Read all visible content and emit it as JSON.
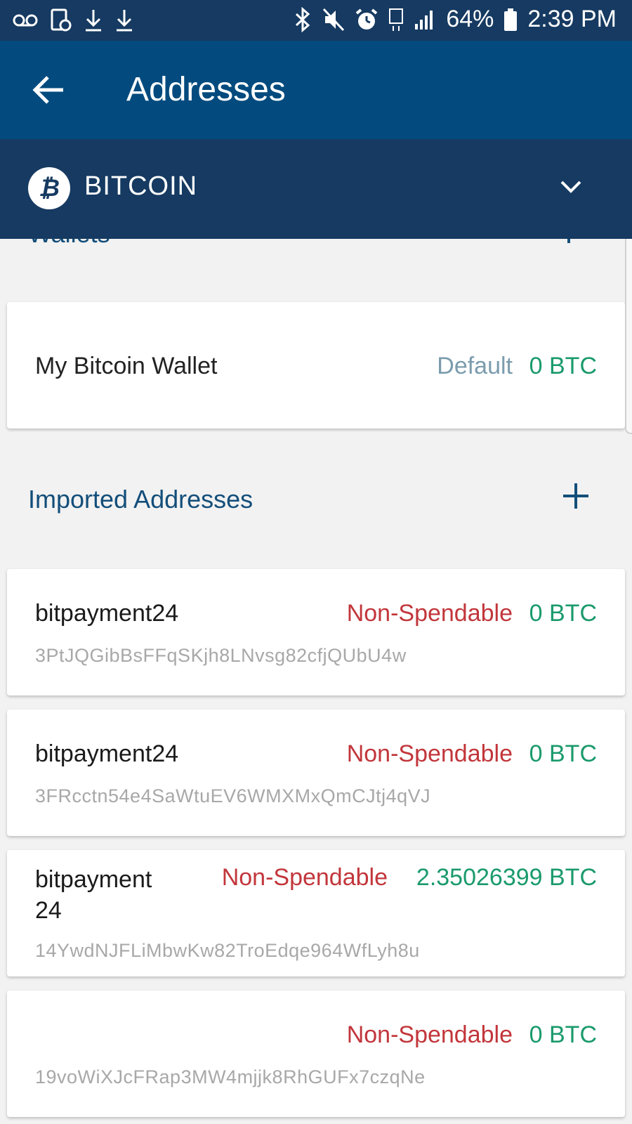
{
  "status_bar": {
    "battery": "64%",
    "time": "2:39 PM",
    "left_icons": [
      "voicemail-icon",
      "screen-record-icon",
      "download-icon",
      "download-icon"
    ],
    "right_icons": [
      "bluetooth-icon",
      "mute-icon",
      "alarm-icon",
      "4g-lte-icon",
      "signal-icon",
      "battery-icon"
    ]
  },
  "app_bar": {
    "title": "Addresses",
    "back_icon": "arrow-left-icon"
  },
  "coin_selector": {
    "name": "BITCOIN",
    "logo_glyph": "₿",
    "chevron_icon": "chevron-down-icon"
  },
  "wallets_section": {
    "title": "Wallets",
    "add_icon": "plus-icon",
    "items": [
      {
        "name": "My Bitcoin Wallet",
        "badge": "Default",
        "balance": "0 BTC"
      }
    ]
  },
  "imported_section": {
    "title": "Imported Addresses",
    "add_icon": "plus-icon",
    "items": [
      {
        "label": "bitpayment24",
        "status": "Non-Spendable",
        "balance": "0 BTC",
        "address": "3PtJQGibBsFFqSKjh8LNvsg82cfjQUbU4w"
      },
      {
        "label": "bitpayment24",
        "status": "Non-Spendable",
        "balance": "0 BTC",
        "address": "3FRcctn54e4SaWtuEV6WMXMxQmCJtj4qVJ"
      },
      {
        "label": "bitpayment 24",
        "status": "Non-Spendable",
        "balance": "2.35026399 BTC",
        "address": "14YwdNJFLiMbwKw82TroEdqe964WfLyh8u"
      },
      {
        "label": "",
        "status": "Non-Spendable",
        "balance": "0 BTC",
        "address": "19voWiXJcFRap3MW4mjjk8RhGUFx7czqNe"
      }
    ]
  },
  "colors": {
    "status_bar_bg": "#163a61",
    "app_bar_bg": "#034b7e",
    "balance_green": "#1a9a6c",
    "non_spendable_red": "#c2363b",
    "default_badge": "#7b9cae",
    "section_title": "#134e7a"
  }
}
